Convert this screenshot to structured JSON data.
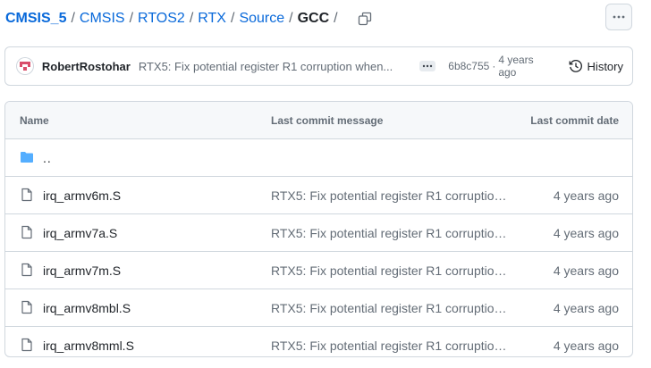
{
  "breadcrumb": {
    "items": [
      "CMSIS_5",
      "CMSIS",
      "RTOS2",
      "RTX",
      "Source"
    ],
    "current": "GCC",
    "separator": "/"
  },
  "commit": {
    "author": "RobertRostohar",
    "message": "RTX5: Fix potential register R1 corruption when...",
    "sha": "6b8c755",
    "dot": "·",
    "age": "4 years ago",
    "history_label": "History"
  },
  "table": {
    "headers": {
      "name": "Name",
      "message": "Last commit message",
      "date": "Last commit date"
    },
    "parent": "..",
    "files": [
      {
        "name": "irq_armv6m.S",
        "message": "RTX5: Fix potential register R1 corruption ...",
        "date": "4 years ago"
      },
      {
        "name": "irq_armv7a.S",
        "message": "RTX5: Fix potential register R1 corruption ...",
        "date": "4 years ago"
      },
      {
        "name": "irq_armv7m.S",
        "message": "RTX5: Fix potential register R1 corruption ...",
        "date": "4 years ago"
      },
      {
        "name": "irq_armv8mbl.S",
        "message": "RTX5: Fix potential register R1 corruption ...",
        "date": "4 years ago"
      },
      {
        "name": "irq_armv8mml.S",
        "message": "RTX5: Fix potential register R1 corruption ...",
        "date": "4 years ago"
      }
    ]
  },
  "icons": {
    "copy": "copy-icon",
    "more": "kebab-horizontal-icon",
    "history": "history-clock-icon",
    "folder": "folder-icon",
    "file": "file-icon"
  },
  "colors": {
    "link": "#0969da",
    "folder": "#54aeff",
    "border": "#d0d7de",
    "muted": "#636c76",
    "avatar_accent": "#d94e6a"
  }
}
